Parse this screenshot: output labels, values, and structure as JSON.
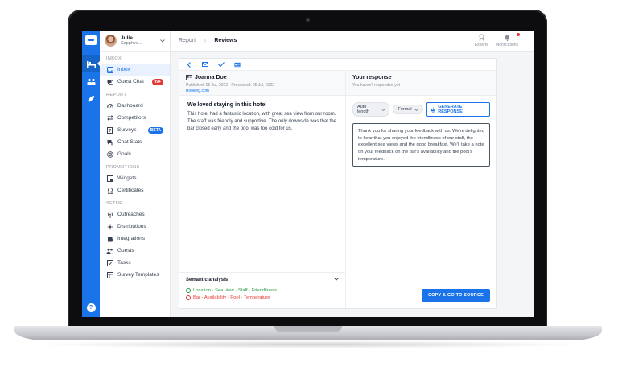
{
  "header": {
    "breadcrumb": [
      "Report",
      "Reviews"
    ],
    "actions": [
      {
        "label": "Experts",
        "icon": "experts-icon"
      },
      {
        "label": "Notifications",
        "icon": "bell-icon"
      }
    ]
  },
  "user": {
    "name": "Julie..",
    "hotel": "Sapphire..."
  },
  "sidebar": {
    "sections": [
      {
        "title": "INBOX",
        "items": [
          {
            "label": "Inbox",
            "icon": "inbox-icon",
            "active": true
          },
          {
            "label": "Guest Chat",
            "icon": "chat-icon",
            "badge": "99+"
          }
        ]
      },
      {
        "title": "REPORT",
        "items": [
          {
            "label": "Dashboard",
            "icon": "gauge-icon"
          },
          {
            "label": "Competitors",
            "icon": "arrows-icon"
          },
          {
            "label": "Surveys",
            "icon": "survey-icon",
            "badge": "BETA"
          },
          {
            "label": "Chat Stats",
            "icon": "chat-stats-icon"
          },
          {
            "label": "Goals",
            "icon": "target-icon"
          }
        ]
      },
      {
        "title": "PROMOTIONS",
        "items": [
          {
            "label": "Widgets",
            "icon": "widget-icon"
          },
          {
            "label": "Certificates",
            "icon": "ribbon-icon"
          }
        ]
      },
      {
        "title": "SETUP",
        "items": [
          {
            "label": "Outreaches",
            "icon": "broadcast-icon"
          },
          {
            "label": "Distributions",
            "icon": "distribution-icon"
          },
          {
            "label": "Integrations",
            "icon": "puzzle-icon"
          },
          {
            "label": "Guests",
            "icon": "people-icon"
          },
          {
            "label": "Tasks",
            "icon": "checkbox-icon"
          },
          {
            "label": "Survey Templates",
            "icon": "templates-icon"
          }
        ]
      }
    ]
  },
  "review": {
    "guest": "Joanna Doe",
    "meta": "Published: 05 Jul, 2022 · Processed: 05 Jul, 2022",
    "source": "Booking.com",
    "title": "We loved staying in this hotel",
    "body": "This hotel had a fantastic location, with great sea view from our room. The staff was friendly and supportive. The only downside was that the bar closed early and the pool was too cold for us."
  },
  "semantic": {
    "title": "Semantic analysis",
    "positive": "Location · Sea view · Staff - Friendliness",
    "negative": "Bar - Availability · Pool - Temperature"
  },
  "response": {
    "title": "Your response",
    "subtitle": "You haven't responded yet",
    "length": "Auto length",
    "tone": "Formal",
    "generate": "GENERATE RESPONSE",
    "text": "Thank you for sharing your feedback with us. We're delighted to hear that you enjoyed the friendliness of our staff, the excellent sea views and the good breakfast. We'll take a note on your feedback on the bar's availability and the pool's temperature.",
    "copy": "COPY & GO TO SOURCE"
  },
  "colors": {
    "accent": "#1a73e8",
    "positive": "#2e9e44",
    "negative": "#e53935"
  }
}
